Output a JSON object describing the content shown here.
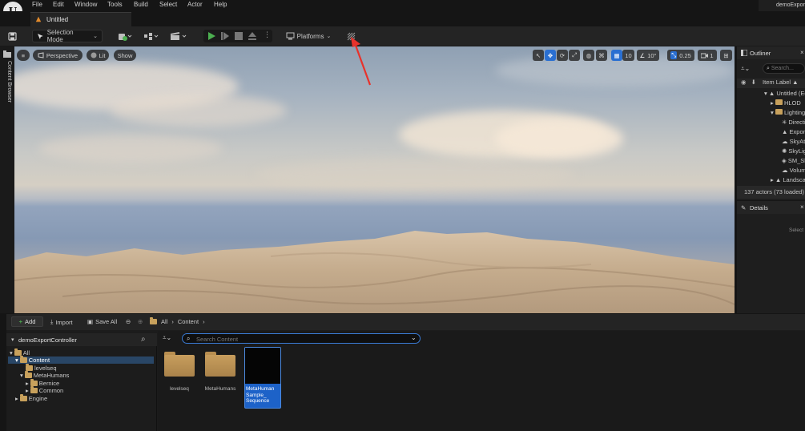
{
  "menu": [
    "File",
    "Edit",
    "Window",
    "Tools",
    "Build",
    "Select",
    "Actor",
    "Help"
  ],
  "project_name": "demoExportController",
  "document_tab": "Untitled",
  "toolbar": {
    "selection_mode": "Selection Mode",
    "platforms": "Platforms"
  },
  "side_tab": "Content Browser",
  "viewport": {
    "perspective": "Perspective",
    "lit": "Lit",
    "show": "Show",
    "grid_value": "10",
    "angle_value": "10°",
    "scale_value": "0.25",
    "camera_speed": "1"
  },
  "outliner": {
    "title": "Outliner",
    "search_placeholder": "Search...",
    "column": "Item Label ▲",
    "rows": [
      "Untitled (Editor)",
      "HLOD",
      "Lighting",
      "DirectionalLight",
      "ExponentialHeightFog",
      "SkyAtmosphere",
      "SkyLight",
      "SM_SkySphere",
      "VolumetricCloud",
      "Landscape"
    ],
    "actor_count": "137 actors (73 loaded)"
  },
  "details": {
    "title": "Details",
    "empty_text": "Select an object to view details."
  },
  "content_browser": {
    "add": "Add",
    "import": "Import",
    "save_all": "Save All",
    "breadcrumb_root": "All",
    "breadcrumb_current": "Content",
    "tree_title": "demoExportController",
    "tree": [
      "All",
      "Content",
      "levelseq",
      "MetaHumans",
      "Bernice",
      "Common",
      "Engine"
    ],
    "search_placeholder": "Search Content",
    "assets": [
      {
        "label": "levelseq"
      },
      {
        "label": "MetaHumans"
      },
      {
        "label": "MetaHuman Sample_ Sequence"
      }
    ]
  },
  "colors": {
    "accent": "#2a6fd1",
    "folder": "#c8a15c",
    "annotation": "#e8322b"
  }
}
